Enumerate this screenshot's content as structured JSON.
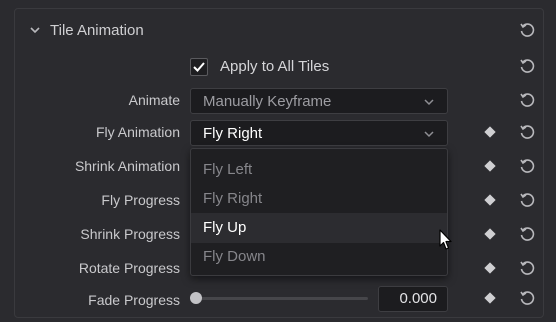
{
  "section": {
    "title": "Tile Animation"
  },
  "apply_all": {
    "label": "Apply to All Tiles",
    "checked": true
  },
  "rows": {
    "animate": {
      "label": "Animate",
      "value": "Manually Keyframe"
    },
    "fly_animation": {
      "label": "Fly Animation",
      "value": "Fly Right"
    },
    "shrink_animation": {
      "label": "Shrink Animation"
    },
    "fly_progress": {
      "label": "Fly Progress"
    },
    "shrink_progress": {
      "label": "Shrink Progress"
    },
    "rotate_progress": {
      "label": "Rotate Progress"
    },
    "fade_progress": {
      "label": "Fade Progress",
      "value": "0.000",
      "slider_fraction": 0.0
    }
  },
  "dropdown": {
    "options": [
      "Fly Left",
      "Fly Right",
      "Fly Up",
      "Fly Down"
    ],
    "hovered": "Fly Up"
  },
  "colors": {
    "background": "#2b2b2f",
    "field": "#1c1c1f",
    "text": "#c9c9cc",
    "highlight": "#ffffff"
  },
  "icons": [
    "chevron-down-icon",
    "checkmark-icon",
    "keyframe-diamond-icon",
    "reset-icon",
    "caret-down-icon",
    "mouse-pointer-icon"
  ]
}
